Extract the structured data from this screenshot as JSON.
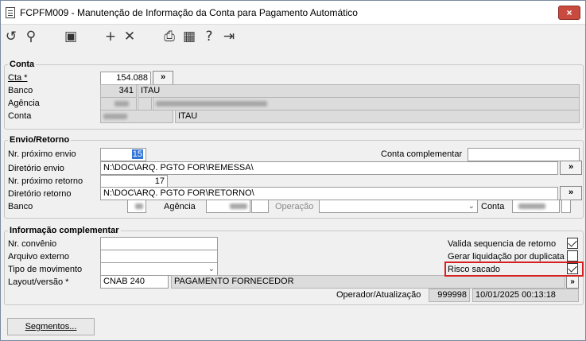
{
  "window": {
    "title": "FCPFM009 - Manutenção de Informação da Conta para Pagamento Automático",
    "close_label": "×"
  },
  "toolbar": {
    "icons": [
      "undo-icon",
      "search-icon",
      "save-icon",
      "add-icon",
      "close-icon",
      "print-icon",
      "calendar-icon",
      "help-icon",
      "exit-icon"
    ],
    "glyphs": {
      "undo": "↺",
      "search": "⚲",
      "save": "▣",
      "add": "+",
      "delete": "✕",
      "print": "⎙",
      "calendar": "▦",
      "help": "?",
      "exit": "⇥"
    }
  },
  "conta": {
    "legend": "Conta",
    "cta_label": "Cta *",
    "cta_value": "154.088",
    "banco_label": "Banco",
    "banco_code": "341",
    "banco_name": "ITAU",
    "agencia_label": "Agência",
    "conta_label": "Conta",
    "conta_name": "ITAU",
    "lookup_button": "»"
  },
  "envio": {
    "legend": "Envio/Retorno",
    "nr_envio_label": "Nr. próximo envio",
    "nr_envio_value": "15",
    "conta_compl_label": "Conta complementar",
    "dir_envio_label": "Diretório envio",
    "dir_envio_value": "N:\\DOC\\ARQ. PGTO FOR\\REMESSA\\",
    "nr_retorno_label": "Nr. próximo retorno",
    "nr_retorno_value": "17",
    "dir_retorno_label": "Diretório retorno",
    "dir_retorno_value": "N:\\DOC\\ARQ. PGTO FOR\\RETORNO\\",
    "banco_label": "Banco",
    "agencia_label": "Agência",
    "operacao_label": "Operação",
    "conta_label": "Conta",
    "browse_button": "»"
  },
  "info": {
    "legend": "Informação complementar",
    "nr_convenio_label": "Nr. convênio",
    "arquivo_label": "Arquivo externo",
    "tipo_mov_label": "Tipo de movimento",
    "layout_label": "Layout/versão *",
    "layout_value": "CNAB 240",
    "layout_desc": "PAGAMENTO FORNECEDOR",
    "valida_label": "Valida sequencia de retorno",
    "valida_checked": true,
    "gerar_label": "Gerar liquidação por duplicata",
    "gerar_checked": false,
    "risco_label": "Risco sacado",
    "risco_checked": true,
    "operador_label": "Operador/Atualização",
    "operador_value": "999998",
    "atualizacao_value": "10/01/2025 00:13:18",
    "more_button": "»"
  },
  "footer": {
    "segmentos_button": "Segmentos..."
  }
}
